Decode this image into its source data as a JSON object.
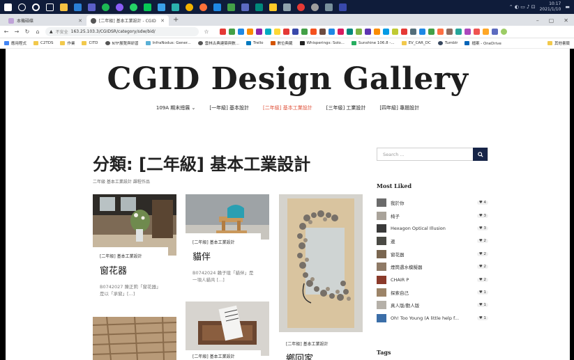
{
  "colors": {
    "accent": "#e0533b",
    "search_button": "#162447",
    "taskbar": "#0f1c3a"
  },
  "taskbar": {
    "icons": [
      "windows-icon",
      "search-icon",
      "cortana-icon",
      "task-view-icon",
      "file-explorer-icon",
      "vscode-icon",
      "teams-icon",
      "spotify-icon",
      "messenger-icon",
      "whatsapp-icon",
      "line-icon",
      "app-icon",
      "app-icon",
      "chrome-icon",
      "firefox-icon",
      "app-icon",
      "app-icon",
      "app-icon",
      "app-icon",
      "app-icon",
      "app-icon",
      "app-icon",
      "app-icon",
      "app-icon",
      "app-icon"
    ],
    "clock_time": "10:17",
    "clock_date": "2021/1/10"
  },
  "browser": {
    "tabs": [
      {
        "label": "本機磁碟",
        "active": false
      },
      {
        "label": "[二年級] 基本工業設計 - CGID",
        "active": true
      }
    ],
    "url": "163.25.103.3/CGIDSR/category/sdw/bid/",
    "url_notice": "不安全",
    "bookmarks": [
      "應用程式",
      "C2TDS",
      "作業",
      "CITD",
      "NTF展覽與研習",
      "InfraNodus: Gener...",
      "雲林古典建築與數...",
      "Trello",
      "數位典藏",
      "Whisperings: Solo...",
      "Sunshine 106.8 -...",
      "EV_CAR_DC",
      "Tumblr",
      "檔案 - OneDrive",
      "其他書籤"
    ]
  },
  "site": {
    "title": "CGID Design Gallery",
    "nav": [
      {
        "label": "109A 期末總展 ⌄",
        "current": false
      },
      {
        "label": "[一年級] 基本設計",
        "current": false
      },
      {
        "label": "[二年級] 基本工業設計",
        "current": true
      },
      {
        "label": "[三年級] 工業設計",
        "current": false
      },
      {
        "label": "[四年級] 專題設計",
        "current": false
      }
    ]
  },
  "category": {
    "heading": "分類: [二年級] 基本工業設計",
    "description": "二年級 基本工業設計 課程作品"
  },
  "posts": [
    {
      "category": "[二年級] 基本工業設計",
      "title": "窗花器",
      "excerpt": "B0742027 陳正莉「窗花器」是以「承窗」[...]"
    },
    {
      "category": "[二年級] 基本工業設計",
      "title": "貓伴",
      "excerpt": "B0742024 賴子瑄「貓伴」是一項人貓共 [...]"
    },
    {
      "category": "[二年級] 基本工業設計",
      "title": "鄉回家",
      "excerpt": ""
    },
    {
      "category": "[二年級] 基本工業設計",
      "title": "",
      "excerpt": ""
    }
  ],
  "sidebar": {
    "search_placeholder": "Search ...",
    "most_liked_title": "Most Liked",
    "tags_title": "Tags",
    "most_liked": [
      {
        "title": "我於你",
        "count": "4"
      },
      {
        "title": "椅子",
        "count": "3"
      },
      {
        "title": "Hexagon Optical Illusion",
        "count": "3"
      },
      {
        "title": "邊",
        "count": "2"
      },
      {
        "title": "窗花器",
        "count": "2"
      },
      {
        "title": "煙筒遇水模擬器",
        "count": "2"
      },
      {
        "title": "CHAIR P",
        "count": "2"
      },
      {
        "title": "探索自己",
        "count": "1"
      },
      {
        "title": "真人版/動人版",
        "count": "1"
      },
      {
        "title": "Oh! Too Young (A little help f...",
        "count": "1"
      }
    ]
  }
}
